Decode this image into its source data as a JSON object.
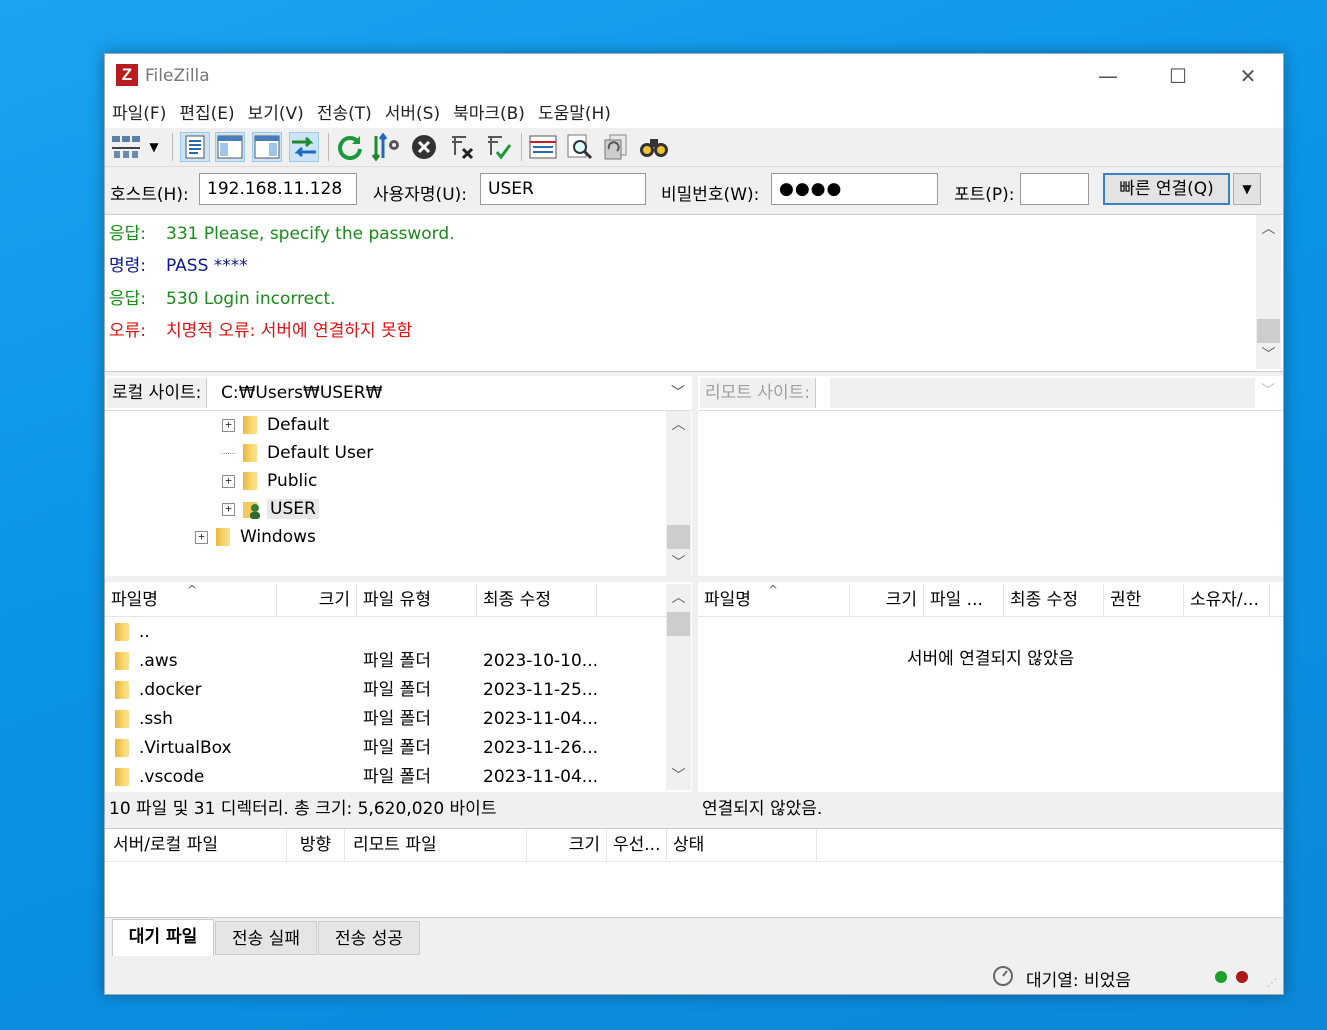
{
  "app": {
    "title": "FileZilla",
    "logo_text": "Z"
  },
  "window_controls": {
    "minimize": "—",
    "maximize": "☐",
    "close": "✕"
  },
  "menu": [
    "파일(F)",
    "편집(E)",
    "보기(V)",
    "전송(T)",
    "서버(S)",
    "북마크(B)",
    "도움말(H)"
  ],
  "toolbar": {
    "buttons": [
      "site-manager-icon",
      "dropdown-arrow-icon",
      "toggle-log-icon",
      "toggle-local-tree-icon",
      "toggle-remote-tree-icon",
      "toggle-queue-icon",
      "refresh-icon",
      "filter-icon",
      "cancel-icon",
      "disconnect-icon",
      "reconnect-icon",
      "directory-listing-icon",
      "search-icon",
      "compare-icon",
      "find-icon"
    ]
  },
  "quickconnect": {
    "host_label": "호스트(H):",
    "host_value": "192.168.11.128",
    "user_label": "사용자명(U):",
    "user_value": "USER",
    "pass_label": "비밀번호(W):",
    "pass_value": "●●●●",
    "port_label": "포트(P):",
    "port_value": "",
    "connect_label": "빠른 연결(Q)",
    "dropdown_arrow": "▼"
  },
  "log": [
    {
      "label": "응답:",
      "text": "331 Please, specify the password.",
      "color": "#1a8a1a"
    },
    {
      "label": "명령:",
      "text": "PASS ****",
      "color": "#0a1a8c"
    },
    {
      "label": "응답:",
      "text": "530 Login incorrect.",
      "color": "#1a8a1a"
    },
    {
      "label": "오류:",
      "text": "치명적 오류: 서버에 연결하지 못함",
      "color": "#e01010"
    }
  ],
  "local": {
    "site_label": "로컬 사이트:",
    "path": "C:₩Users₩USER₩",
    "tree": [
      {
        "name": "Default",
        "expandable": true
      },
      {
        "name": "Default User",
        "expandable": false
      },
      {
        "name": "Public",
        "expandable": true
      },
      {
        "name": "USER",
        "expandable": true,
        "selected": true
      },
      {
        "name": "Windows",
        "expandable": true
      }
    ],
    "columns": [
      "파일명",
      "크기",
      "파일 유형",
      "최종 수정"
    ],
    "files": [
      {
        "name": "..",
        "type": "",
        "modified": ""
      },
      {
        "name": ".aws",
        "type": "파일 폴더",
        "modified": "2023-10-10..."
      },
      {
        "name": ".docker",
        "type": "파일 폴더",
        "modified": "2023-11-25..."
      },
      {
        "name": ".ssh",
        "type": "파일 폴더",
        "modified": "2023-11-04..."
      },
      {
        "name": ".VirtualBox",
        "type": "파일 폴더",
        "modified": "2023-11-26..."
      },
      {
        "name": ".vscode",
        "type": "파일 폴더",
        "modified": "2023-11-04..."
      }
    ],
    "status": "10 파일 및 31 디렉터리. 총 크기: 5,620,020 바이트"
  },
  "remote": {
    "site_label": "리모트 사이트:",
    "path": "",
    "columns": [
      "파일명",
      "크기",
      "파일 ...",
      "최종 수정",
      "권한",
      "소유자/..."
    ],
    "empty_message": "서버에 연결되지 않았음",
    "status": "연결되지 않았음."
  },
  "queue": {
    "columns": [
      "서버/로컬 파일",
      "방향",
      "리모트 파일",
      "크기",
      "우선...",
      "상태"
    ],
    "tabs": [
      "대기 파일",
      "전송 실패",
      "전송 성공"
    ],
    "active_tab": 0
  },
  "statusbar": {
    "queue_text": "대기열: 비었음",
    "led_colors": [
      "#1e9e2a",
      "#b01818"
    ]
  }
}
